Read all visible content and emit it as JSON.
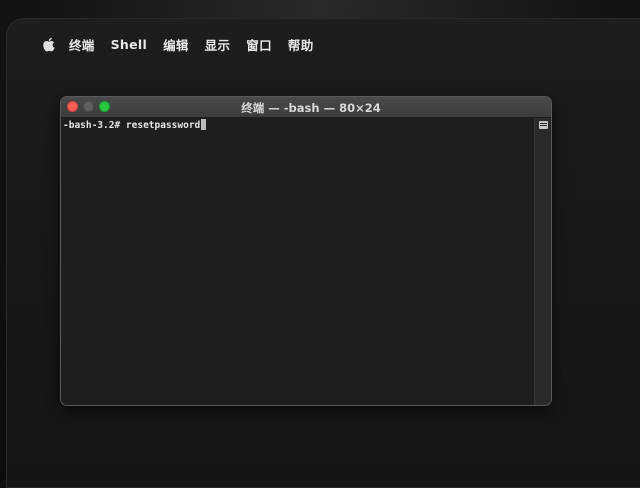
{
  "menubar": {
    "apple_icon": "apple-logo-icon",
    "items": [
      "终端",
      "Shell",
      "编辑",
      "显示",
      "窗口",
      "帮助"
    ]
  },
  "window": {
    "title": "终端 — -bash — 80×24",
    "traffic_lights": {
      "close_color": "#ff5f57",
      "minimize_color": "#5f5f5f",
      "maximize_color": "#28c840"
    }
  },
  "terminal": {
    "prompt": "-bash-3.2# ",
    "command": "resetpassword"
  },
  "colors": {
    "terminal_bg": "#1e1e1e",
    "text": "#e6e6e6"
  }
}
